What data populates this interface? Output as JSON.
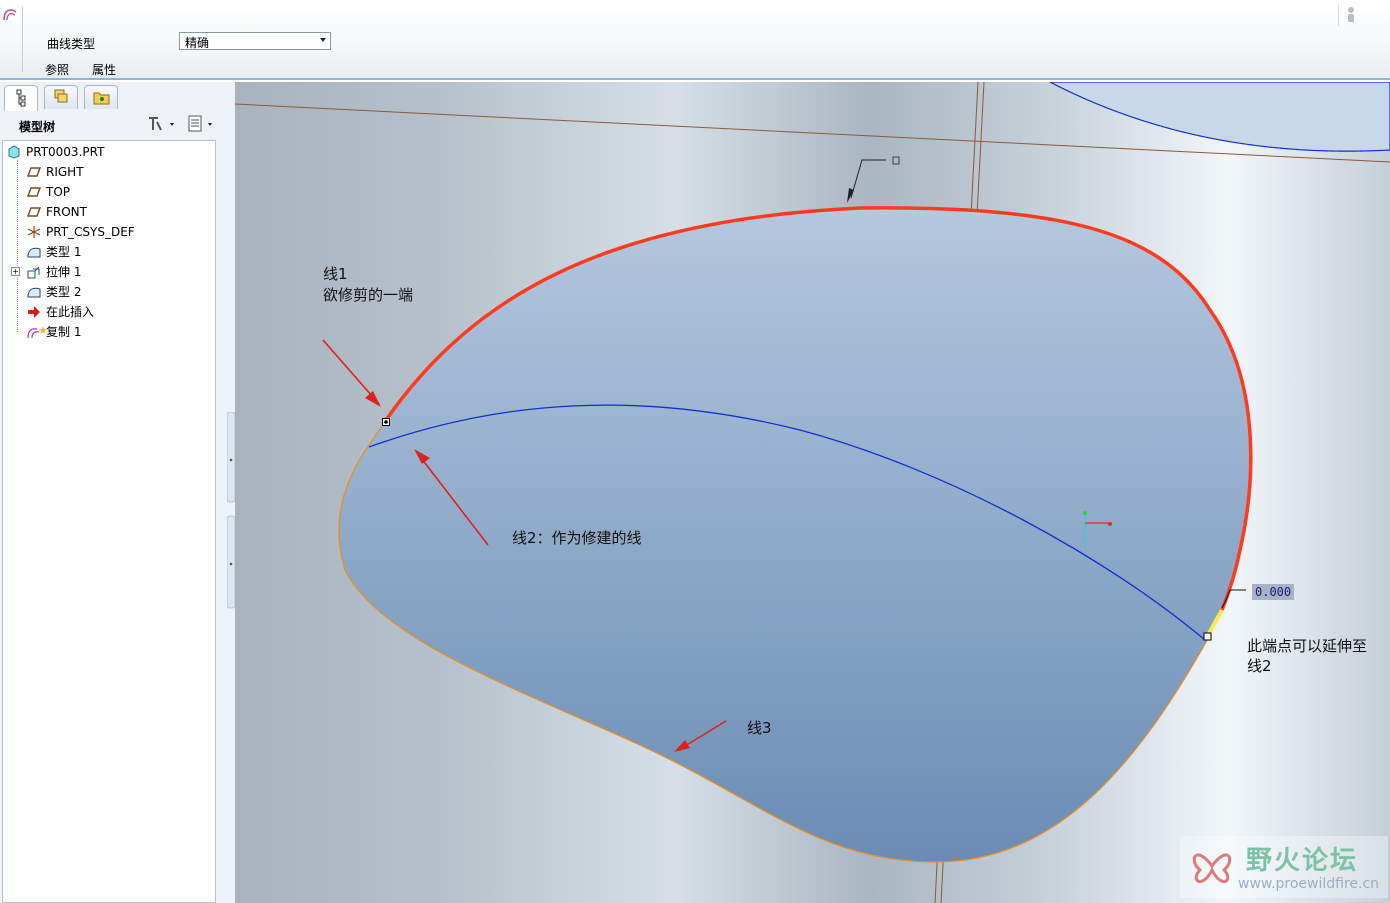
{
  "ribbon": {
    "curve_type_label": "曲线类型",
    "curve_type_value": "精确",
    "tab_references": "参照",
    "tab_properties": "属性"
  },
  "left_panel": {
    "model_tree_title": "模型树",
    "tree": [
      {
        "label": "PRT0003.PRT",
        "icon": "part-icon"
      },
      {
        "label": "RIGHT",
        "icon": "datum-plane-icon"
      },
      {
        "label": "TOP",
        "icon": "datum-plane-icon"
      },
      {
        "label": "FRONT",
        "icon": "datum-plane-icon"
      },
      {
        "label": "PRT_CSYS_DEF",
        "icon": "csys-icon"
      },
      {
        "label": "类型 1",
        "icon": "surface-icon"
      },
      {
        "label": "拉伸 1",
        "icon": "extrude-icon"
      },
      {
        "label": "类型 2",
        "icon": "surface-icon"
      },
      {
        "label": "在此插入",
        "icon": "insert-here-arrow-icon"
      },
      {
        "label": "复制 1",
        "icon": "copy-surface-icon"
      }
    ]
  },
  "annotations": {
    "line1_title": "线1",
    "line1_desc": "欲修剪的一端",
    "line2": "线2：作为修建的线",
    "line3": "线3",
    "endpoint_line1": "此端点可以延伸至",
    "endpoint_line2": "线2",
    "dimension_value": "0.000"
  },
  "watermark": {
    "title": "野火论坛",
    "url": "www.proewildfire.cn"
  },
  "colors": {
    "selected_curve": "#ff3a1e",
    "trim_curve": "#1030d0",
    "edge_curve": "#e0902a",
    "annotation_arrow": "#e0201c",
    "surface_top": "#b4c8de",
    "surface_bottom": "#6a8cb4"
  }
}
